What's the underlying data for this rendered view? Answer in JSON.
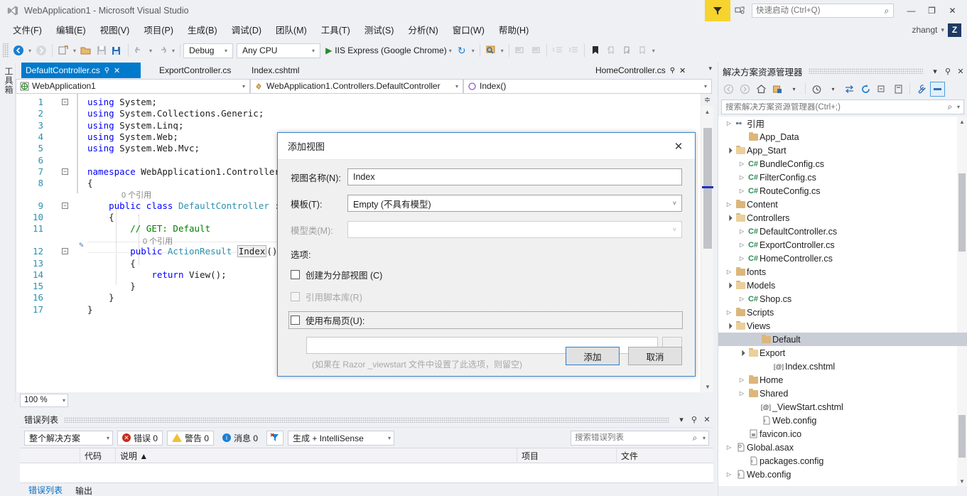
{
  "window": {
    "title": "WebApplication1 - Microsoft Visual Studio",
    "minimize": "—",
    "maximize": "❐",
    "close": "✕"
  },
  "quick_launch": {
    "placeholder": "快速启动 (Ctrl+Q)",
    "value": "",
    "search_glyph": "⌕"
  },
  "account": {
    "name": "zhangt",
    "caret": "▾",
    "avatar_initial": "Z"
  },
  "menubar": {
    "items": [
      "文件(F)",
      "编辑(E)",
      "视图(V)",
      "项目(P)",
      "生成(B)",
      "调试(D)",
      "团队(M)",
      "工具(T)",
      "测试(S)",
      "分析(N)",
      "窗口(W)",
      "帮助(H)"
    ]
  },
  "toolbar": {
    "back_glyph": "◉",
    "forward_glyph": "◉",
    "new_project_glyph": "⌸",
    "open_glyph": "📂",
    "save_glyph": "💾",
    "save_all_glyph": "🖫",
    "undo_glyph": "↩",
    "redo_glyph": "↪",
    "config": "Debug",
    "platform": "Any CPU",
    "start_glyph": "▶",
    "run_target": "IIS Express (Google Chrome)",
    "refresh_glyph": "↻",
    "caret": "▾"
  },
  "toolbox": {
    "label": "工具箱"
  },
  "editor": {
    "tabs": [
      {
        "label": "DefaultController.cs",
        "active": true,
        "pin": "⚲",
        "close": "✕"
      },
      {
        "label": "ExportController.cs",
        "active": false
      },
      {
        "label": "Index.cshtml",
        "active": false
      },
      {
        "label": "HomeController.cs",
        "active": false,
        "pin": "⚲",
        "close": "✕"
      }
    ],
    "tab_overflow": "▾",
    "nav": {
      "project": "WebApplication1",
      "class": "WebApplication1.Controllers.DefaultController",
      "member": "Index()",
      "caret": "▾"
    },
    "zoom": "100 %",
    "zoom_caret": "▾",
    "lines": [
      {
        "n": 1,
        "fold": "−",
        "html": "<span class='kw'>using</span> System;"
      },
      {
        "n": 2,
        "html": "<span class='kw'>using</span> System.Collections.Generic;"
      },
      {
        "n": 3,
        "html": "<span class='kw'>using</span> System.Linq;"
      },
      {
        "n": 4,
        "html": "<span class='kw'>using</span> System.Web;"
      },
      {
        "n": 5,
        "html": "<span class='kw'>using</span> System.Web.Mvc;"
      },
      {
        "n": 6,
        "html": ""
      },
      {
        "n": 7,
        "fold": "−",
        "html": "<span class='kw'>namespace</span> WebApplication1.Controllers"
      },
      {
        "n": 8,
        "html": "{"
      },
      {
        "n": 9,
        "fold": "−",
        "html": "    <span class='kw'>public</span> <span class='kw'>class</span> <span class='ty'>DefaultController</span> : C"
      },
      {
        "n": 10,
        "html": "    {"
      },
      {
        "n": 11,
        "html": "        <span class='cm'>// GET: Default</span>"
      },
      {
        "n": 12,
        "fold": "−",
        "html": "        <span class='kw'>public</span> <span class='ty'>ActionResult</span> <span class='idx-box'>Index</span>()"
      },
      {
        "n": 13,
        "html": "        {"
      },
      {
        "n": 14,
        "html": "            <span class='kw'>return</span> View();"
      },
      {
        "n": 15,
        "html": "        }"
      },
      {
        "n": 16,
        "html": "    }"
      },
      {
        "n": 17,
        "html": "}"
      }
    ],
    "codelens_class": "0 个引用",
    "codelens_method": "0 个引用"
  },
  "dialog": {
    "title": "添加视图",
    "close_glyph": "✕",
    "view_name_label": "视图名称(N):",
    "view_name_value": "Index",
    "template_label": "模板(T):",
    "template_value": "Empty (不具有模型)",
    "model_class_label": "模型类(M):",
    "model_class_value": "",
    "options_label": "选项:",
    "checkbox_partial": "创建为分部视图 (C)",
    "checkbox_script_libs": "引用脚本库(R)",
    "checkbox_layout": "使用布局页(U):",
    "layout_value": "",
    "browse_label": "...",
    "hint": "(如果在 Razor _viewstart 文件中设置了此选项，则留空)",
    "add_button": "添加",
    "cancel_button": "取消",
    "caret": "˅"
  },
  "error_list": {
    "title": "错误列表",
    "caret": "▾",
    "pin": "⚲",
    "close": "✕",
    "scope": "整个解决方案",
    "errors_label": "错误 0",
    "warnings_label": "警告 0",
    "messages_label": "消息 0",
    "filter_glyph": "⚲",
    "build_filter": "生成 + IntelliSense",
    "search_placeholder": "搜索错误列表",
    "search_value": "",
    "columns": [
      "",
      "代码",
      "说明 ▲",
      "项目",
      "文件"
    ],
    "rows": [],
    "tabs": [
      {
        "label": "错误列表",
        "active": true
      },
      {
        "label": "输出",
        "active": false
      }
    ]
  },
  "solution_explorer": {
    "title": "解决方案资源管理器",
    "caret": "▾",
    "pin": "⚲",
    "close": "✕",
    "toolbar": [
      {
        "name": "back",
        "glyph": "◉"
      },
      {
        "name": "forward",
        "glyph": "◉"
      },
      {
        "name": "home",
        "glyph": "⌂"
      },
      {
        "name": "pending-changes",
        "glyph": "▣"
      },
      {
        "name": "dropdown",
        "glyph": "▾"
      },
      {
        "name": "history",
        "glyph": "◷"
      },
      {
        "name": "history-dropdown",
        "glyph": "▾"
      },
      {
        "name": "sync-with-active-document",
        "glyph": "⇆"
      },
      {
        "name": "refresh",
        "glyph": "↻"
      },
      {
        "name": "collapse-all",
        "glyph": "⊟"
      },
      {
        "name": "show-all-files",
        "glyph": "▤"
      },
      {
        "name": "properties",
        "glyph": "🔧"
      },
      {
        "name": "preview-selected-items",
        "glyph": "▬"
      }
    ],
    "search_placeholder": "搜索解决方案资源管理器(Ctrl+;)",
    "search_value": "",
    "search_glyph": "⌕",
    "search_caret": "▾",
    "tree": [
      {
        "label": "引用",
        "indent": 0,
        "twisty": "collapsed",
        "icon": "references"
      },
      {
        "label": "App_Data",
        "indent": 1,
        "twisty": "none",
        "icon": "folder"
      },
      {
        "label": "App_Start",
        "indent": 0,
        "twisty": "expanded",
        "icon": "folder-open"
      },
      {
        "label": "BundleConfig.cs",
        "indent": 1,
        "twisty": "collapsed",
        "icon": "cs"
      },
      {
        "label": "FilterConfig.cs",
        "indent": 1,
        "twisty": "collapsed",
        "icon": "cs"
      },
      {
        "label": "RouteConfig.cs",
        "indent": 1,
        "twisty": "collapsed",
        "icon": "cs"
      },
      {
        "label": "Content",
        "indent": 0,
        "twisty": "collapsed",
        "icon": "folder"
      },
      {
        "label": "Controllers",
        "indent": 0,
        "twisty": "expanded",
        "icon": "folder-open"
      },
      {
        "label": "DefaultController.cs",
        "indent": 1,
        "twisty": "collapsed",
        "icon": "cs"
      },
      {
        "label": "ExportController.cs",
        "indent": 1,
        "twisty": "collapsed",
        "icon": "cs"
      },
      {
        "label": "HomeController.cs",
        "indent": 1,
        "twisty": "collapsed",
        "icon": "cs"
      },
      {
        "label": "fonts",
        "indent": 0,
        "twisty": "collapsed",
        "icon": "folder"
      },
      {
        "label": "Models",
        "indent": 0,
        "twisty": "expanded",
        "icon": "folder-open"
      },
      {
        "label": "Shop.cs",
        "indent": 1,
        "twisty": "collapsed",
        "icon": "cs"
      },
      {
        "label": "Scripts",
        "indent": 0,
        "twisty": "collapsed",
        "icon": "folder"
      },
      {
        "label": "Views",
        "indent": 0,
        "twisty": "expanded",
        "icon": "folder-open"
      },
      {
        "label": "Default",
        "indent": 2,
        "twisty": "none",
        "icon": "folder",
        "selected": true
      },
      {
        "label": "Export",
        "indent": 1,
        "twisty": "expanded",
        "icon": "folder-open"
      },
      {
        "label": "Index.cshtml",
        "indent": 3,
        "twisty": "none",
        "icon": "razor"
      },
      {
        "label": "Home",
        "indent": 1,
        "twisty": "collapsed",
        "icon": "folder"
      },
      {
        "label": "Shared",
        "indent": 1,
        "twisty": "collapsed",
        "icon": "folder"
      },
      {
        "label": "_ViewStart.cshtml",
        "indent": 2,
        "twisty": "none",
        "icon": "razor"
      },
      {
        "label": "Web.config",
        "indent": 2,
        "twisty": "none",
        "icon": "config"
      },
      {
        "label": "favicon.ico",
        "indent": 1,
        "twisty": "none",
        "icon": "ico"
      },
      {
        "label": "Global.asax",
        "indent": 0,
        "twisty": "collapsed",
        "icon": "asax"
      },
      {
        "label": "packages.config",
        "indent": 1,
        "twisty": "none",
        "icon": "config"
      },
      {
        "label": "Web.config",
        "indent": 0,
        "twisty": "collapsed",
        "icon": "config"
      }
    ]
  },
  "colors": {
    "accent": "#007acc",
    "chrome": "#eef0f4",
    "editor_bg": "#ffffff",
    "keyword": "#0000ff",
    "type": "#2b91af",
    "comment": "#008000",
    "selection": "#c9cdd6",
    "feedback_yellow": "#f6d32d"
  }
}
